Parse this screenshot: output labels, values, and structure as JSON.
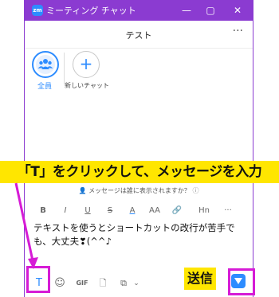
{
  "window": {
    "app_title": "ミーティング チャット",
    "logo_text": "zm",
    "minimize": "—",
    "maximize": "▢",
    "close": "✕"
  },
  "chat": {
    "title": "テスト",
    "more": "···"
  },
  "members": {
    "all_label": "全員",
    "new_chat_label": "新しいチャット",
    "plus": "+"
  },
  "recipient_hint": "メッセージは誰に表示されますか？",
  "formatting_toolbar": [
    "B",
    "I",
    "U",
    "S",
    "A",
    "AA",
    "🔗",
    "Hn",
    "···"
  ],
  "message": {
    "line1": "テキストを使うとショートカットの改行が苦手で",
    "line2": "も、大丈夫❣(^^♪"
  },
  "bottom_bar": {
    "format_toggle": "T",
    "emoji": "☺",
    "gif": "GIF",
    "file": "🗋",
    "screenshot": "⧉",
    "chevron": "⌄"
  },
  "annotations": {
    "banner": "「T」をクリックして、メッセージを入力",
    "send": "送信"
  },
  "colors": {
    "titlebar": "#8b3bd1",
    "accent": "#2d8cff",
    "highlight": "#ffe600",
    "marker": "#d61bd6"
  }
}
